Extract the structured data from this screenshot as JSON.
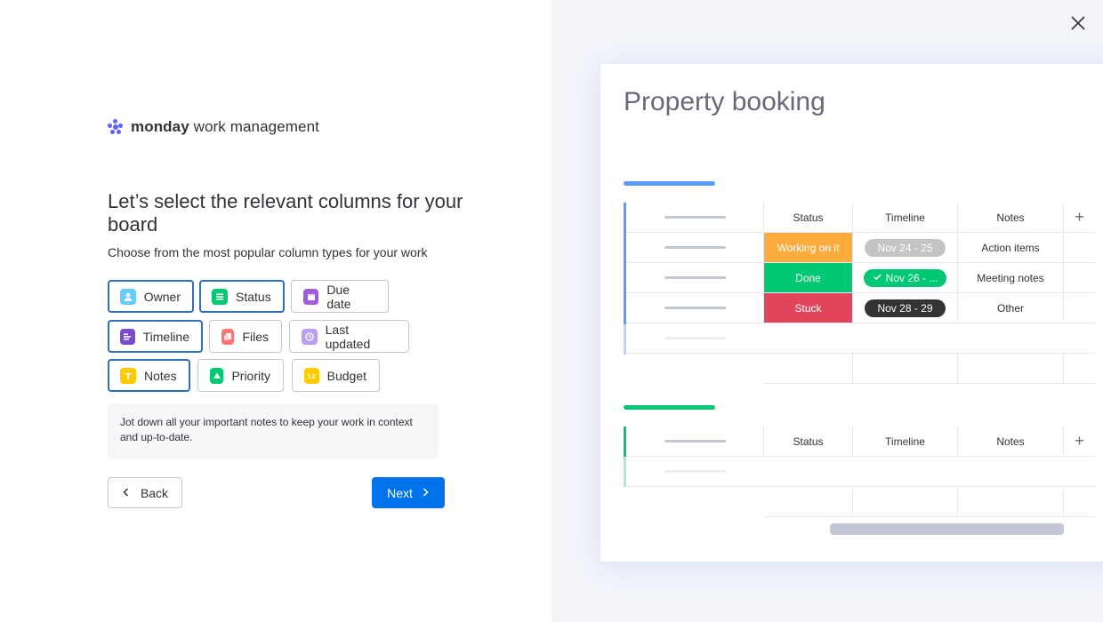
{
  "brand": {
    "name_bold": "monday",
    "name_rest": " work management",
    "color": "#6161ff"
  },
  "heading": "Let’s select the relevant columns for your board",
  "subheading": "Choose from the most popular column types for your work",
  "columns": [
    {
      "label": "Owner",
      "icon": "person-icon",
      "color": "#66ccff",
      "selected": true
    },
    {
      "label": "Status",
      "icon": "status-list-icon",
      "color": "#00c875",
      "selected": true
    },
    {
      "label": "Due date",
      "icon": "calendar-icon",
      "color": "#a25ddc",
      "selected": false
    },
    {
      "label": "Timeline",
      "icon": "timeline-icon",
      "color": "#784bd1",
      "selected": true
    },
    {
      "label": "Files",
      "icon": "files-icon",
      "color": "#ff7575",
      "selected": false
    },
    {
      "label": "Last updated",
      "icon": "clock-icon",
      "color": "#bba0f0",
      "selected": false
    },
    {
      "label": "Notes",
      "icon": "text-icon",
      "color": "#ffcb00",
      "selected": true
    },
    {
      "label": "Priority",
      "icon": "priority-icon",
      "color": "#00c875",
      "selected": false
    },
    {
      "label": "Budget",
      "icon": "numbers-icon",
      "color": "#ffcb00",
      "selected": false
    }
  ],
  "info_text": "Jot down all your important notes to keep your work in context and up-to-date.",
  "buttons": {
    "back": "Back",
    "next": "Next"
  },
  "preview": {
    "title": "Property booking",
    "group1_color": "#579bfc",
    "group2_color": "#00c875",
    "headers": {
      "status": "Status",
      "timeline": "Timeline",
      "notes": "Notes",
      "add": "+"
    },
    "rows": [
      {
        "status": "Working on it",
        "status_color": "#fdab3d",
        "timeline": "Nov 24 - 25",
        "timeline_color": "#c4c4c4",
        "timeline_check": false,
        "notes": "Action items"
      },
      {
        "status": "Done",
        "status_color": "#00c875",
        "timeline": "Nov 26 - ...",
        "timeline_color": "#00c875",
        "timeline_check": true,
        "notes": "Meeting notes"
      },
      {
        "status": "Stuck",
        "status_color": "#e2445c",
        "timeline": "Nov 28 - 29",
        "timeline_color": "#333333",
        "timeline_check": false,
        "notes": "Other"
      }
    ]
  }
}
